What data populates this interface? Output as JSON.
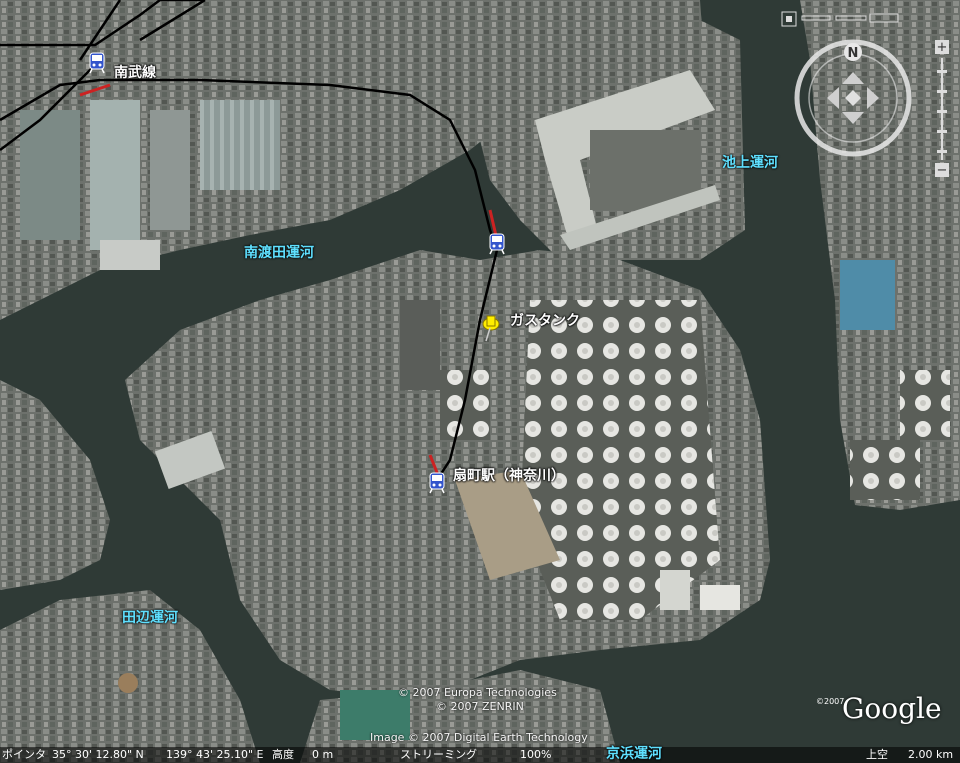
{
  "map": {
    "labels": {
      "nambu_line": "南武線",
      "minami_watarida_canal": "南渡田運河",
      "ikegami_canal": "池上運河",
      "gas_tank": "ガスタンク",
      "ogimachi_station": "扇町駅（神奈川）",
      "tanabe_canal": "田辺運河",
      "keihin_canal": "京浜運河"
    },
    "attribution": {
      "line1": "© 2007 Europa Technologies",
      "line2": "© 2007 ZENRIN",
      "line3": "Image © 2007 Digital Earth Technology"
    },
    "logo": "Google",
    "logo_copyright": "©2007",
    "colors": {
      "canal_label": "#5fe0ff",
      "railway": "#000000",
      "pin": "#ffee00"
    }
  },
  "statusbar": {
    "pointer_label": "ポインタ",
    "latitude": "35° 30' 12.80\" N",
    "longitude": "139° 43' 25.10\" E",
    "elevation_label": "高度",
    "elevation_value": "0 m",
    "streaming_label": "ストリーミング",
    "streaming_value": "100%",
    "eye_label": "上空",
    "eye_value": "2.00 km"
  },
  "nav": {
    "north": "N",
    "zoom_in": "+",
    "zoom_out": "−"
  }
}
